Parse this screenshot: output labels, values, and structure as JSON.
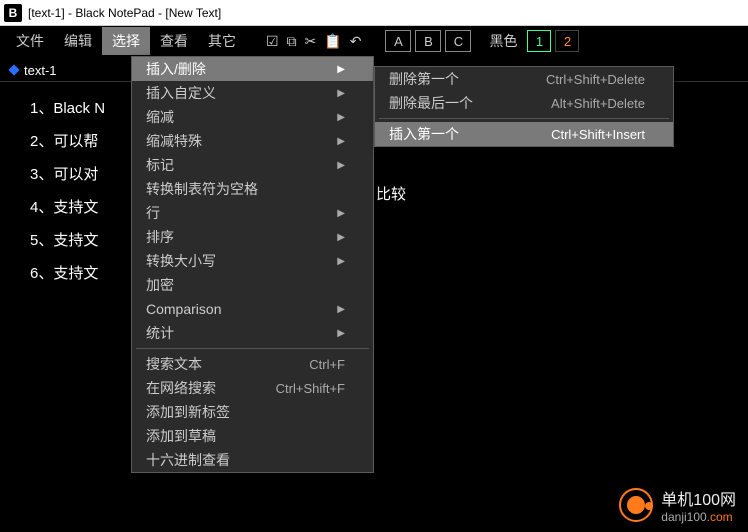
{
  "title": "[text-1] - Black NotePad - [New Text]",
  "app_icon_letter": "B",
  "menubar": {
    "items": [
      "文件",
      "编辑",
      "选择",
      "查看",
      "其它"
    ],
    "active_index": 2,
    "letter_buttons": [
      "A",
      "B",
      "C"
    ],
    "color_label": "黑色",
    "number_buttons": [
      "1",
      "2"
    ]
  },
  "tab": {
    "label": "text-1"
  },
  "editor_lines": [
    "1、Black N",
    "2、可以帮",
    "3、可以对",
    "4、支持文",
    "5、支持文",
    "6、支持文"
  ],
  "editor_partial_right": "比较",
  "dropdown_main": {
    "groups": [
      [
        {
          "label": "插入/删除",
          "arrow": true,
          "highlight": true
        },
        {
          "label": "插入自定义",
          "arrow": true
        },
        {
          "label": "缩减",
          "arrow": true
        },
        {
          "label": "缩减特殊",
          "arrow": true
        },
        {
          "label": "标记",
          "arrow": true
        },
        {
          "label": "转换制表符为空格"
        },
        {
          "label": "行",
          "arrow": true
        },
        {
          "label": "排序",
          "arrow": true
        },
        {
          "label": "转换大小写",
          "arrow": true
        },
        {
          "label": "加密"
        },
        {
          "label": "Comparison",
          "arrow": true
        },
        {
          "label": "统计",
          "arrow": true
        }
      ],
      [
        {
          "label": "搜索文本",
          "shortcut": "Ctrl+F"
        },
        {
          "label": "在网络搜索",
          "shortcut": "Ctrl+Shift+F"
        },
        {
          "label": "添加到新标签"
        },
        {
          "label": "添加到草稿"
        },
        {
          "label": "十六进制查看"
        }
      ]
    ]
  },
  "dropdown_sub": {
    "groups": [
      [
        {
          "label": "删除第一个",
          "shortcut": "Ctrl+Shift+Delete"
        },
        {
          "label": "删除最后一个",
          "shortcut": "Alt+Shift+Delete"
        }
      ],
      [
        {
          "label": "插入第一个",
          "shortcut": "Ctrl+Shift+Insert",
          "highlight": true
        }
      ]
    ]
  },
  "watermark": {
    "line1": "单机100网",
    "domain_left": "danji100",
    "domain_right": ".com"
  }
}
